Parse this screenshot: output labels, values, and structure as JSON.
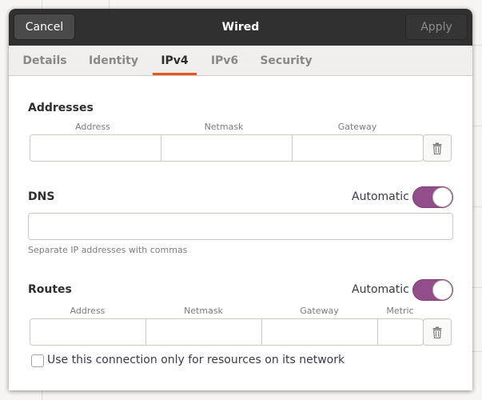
{
  "header": {
    "title": "Wired",
    "cancel_label": "Cancel",
    "apply_label": "Apply"
  },
  "tabs": [
    {
      "label": "Details",
      "active": false
    },
    {
      "label": "Identity",
      "active": false
    },
    {
      "label": "IPv4",
      "active": true
    },
    {
      "label": "IPv6",
      "active": false
    },
    {
      "label": "Security",
      "active": false
    }
  ],
  "addresses": {
    "title": "Addresses",
    "columns": [
      "Address",
      "Netmask",
      "Gateway"
    ],
    "values": [
      "",
      "",
      ""
    ]
  },
  "dns": {
    "title": "DNS",
    "automatic_label": "Automatic",
    "automatic": true,
    "value": "",
    "hint": "Separate IP addresses with commas"
  },
  "routes": {
    "title": "Routes",
    "automatic_label": "Automatic",
    "automatic": true,
    "columns": [
      "Address",
      "Netmask",
      "Gateway",
      "Metric"
    ],
    "values": [
      "",
      "",
      "",
      ""
    ]
  },
  "local_only": {
    "label": "Use this connection only for resources on its network",
    "checked": false
  },
  "colors": {
    "accent": "#e95420",
    "switch_on": "#924d8b",
    "headerbar": "#303030"
  },
  "icons": {
    "delete_address": "trash-icon",
    "delete_route": "trash-icon"
  }
}
